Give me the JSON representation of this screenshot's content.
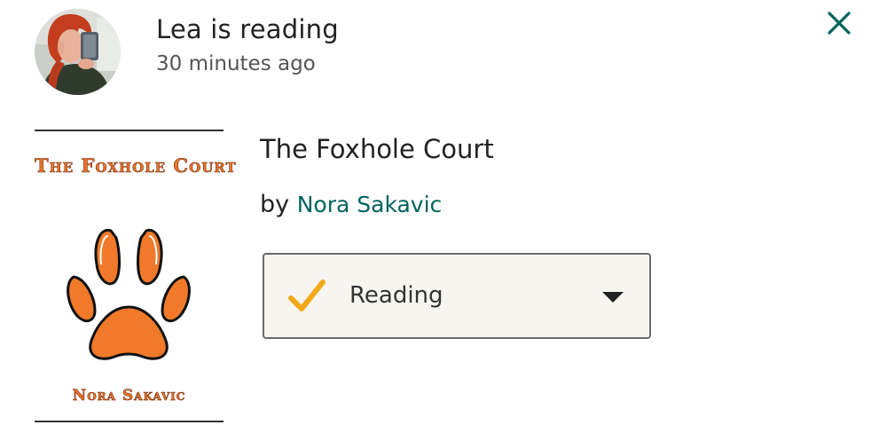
{
  "activity": {
    "title": "Lea is reading",
    "time": "30 minutes ago"
  },
  "icons": {
    "close": "close-icon",
    "check": "check-icon",
    "dropdown": "caret-down-icon",
    "paw": "paw-print-icon"
  },
  "book": {
    "cover_title": "The Foxhole Court",
    "cover_author": "Nora Sakavic",
    "title": "The Foxhole Court",
    "by_prefix": "by",
    "author": "Nora Sakavic"
  },
  "shelf": {
    "status": "Reading"
  },
  "colors": {
    "accent": "#00635d",
    "link": "#00635d",
    "check": "#f2a91a",
    "cover_orange": "#e8742e",
    "dropdown_bg": "#f6f5ef"
  }
}
